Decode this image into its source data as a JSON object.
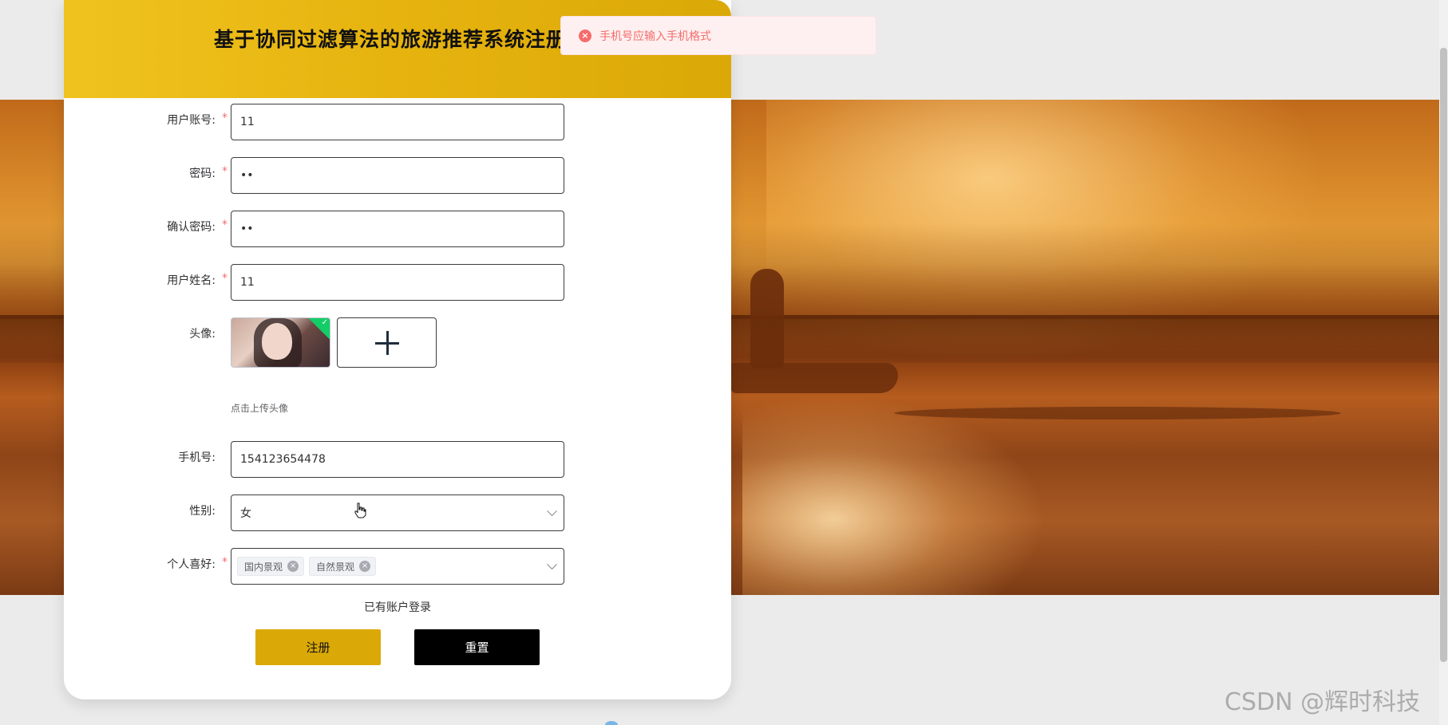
{
  "app": {
    "title": "基于协同过滤算法的旅游推荐系统注册"
  },
  "toast": {
    "message": "手机号应输入手机格式",
    "type": "error",
    "icon": "error-circle-icon"
  },
  "form": {
    "account": {
      "label": "用户账号:",
      "required": "*",
      "value": "11"
    },
    "password": {
      "label": "密码:",
      "required": "*",
      "value": "••"
    },
    "confirm_password": {
      "label": "确认密码:",
      "required": "*",
      "value": "••"
    },
    "real_name": {
      "label": "用户姓名:",
      "required": "*",
      "value": "11"
    },
    "avatar": {
      "label": "头像:",
      "hint": "点击上传头像",
      "upload_icon": "plus-icon",
      "check_icon": "check-icon"
    },
    "phone": {
      "label": "手机号:",
      "value": "154123654478"
    },
    "gender": {
      "label": "性别:",
      "value": "女"
    },
    "hobbies": {
      "label": "个人喜好:",
      "required": "*",
      "tags": [
        "国内景观",
        "自然景观"
      ]
    }
  },
  "links": {
    "login": "已有账户登录"
  },
  "buttons": {
    "register": "注册",
    "reset": "重置"
  },
  "watermark": "CSDN @辉时科技",
  "colors": {
    "accent": "#dba907",
    "header_start": "#f0c31e",
    "error": "#f56c6c",
    "error_bg": "#fef0f0",
    "success": "#13ce66"
  }
}
